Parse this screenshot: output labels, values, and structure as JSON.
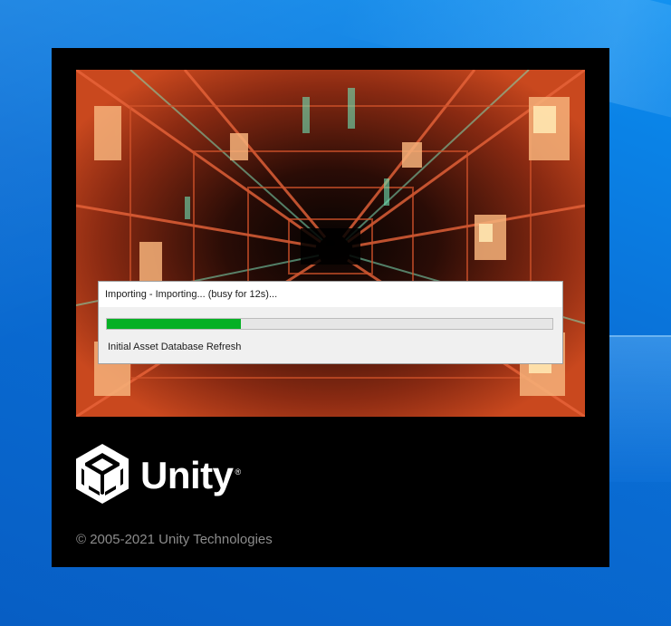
{
  "progress_dialog": {
    "title": "Importing - Importing... (busy for 12s)...",
    "status": "Initial Asset Database Refresh",
    "progress_fraction": 0.3,
    "progress_color": "#06b025"
  },
  "splash": {
    "brand_name": "Unity",
    "registered_mark": "®",
    "copyright": "© 2005-2021 Unity Technologies",
    "logo_icon": "unity-cube-logo-icon",
    "background_color": "#000000"
  },
  "desktop": {
    "background_color": "#0a6fd6"
  }
}
